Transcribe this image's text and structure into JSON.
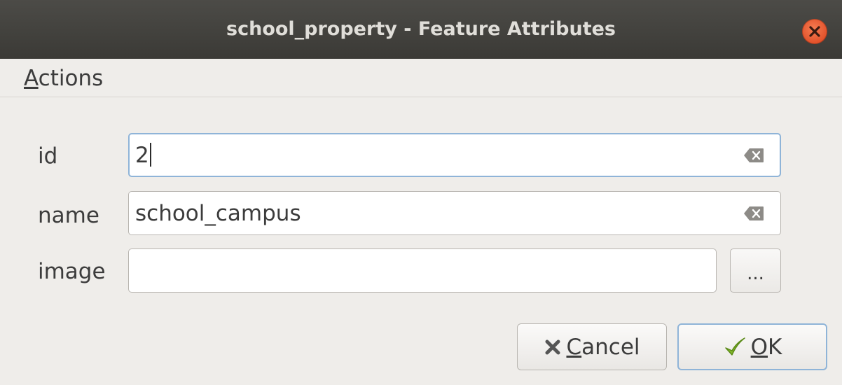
{
  "window": {
    "title": "school_property - Feature Attributes"
  },
  "menubar": {
    "items": [
      {
        "mnemonic": "A",
        "rest": "ctions"
      }
    ]
  },
  "form": {
    "fields": [
      {
        "label": "id",
        "value": "2",
        "focused": true,
        "has_clear": true
      },
      {
        "label": "name",
        "value": "school_campus",
        "focused": false,
        "has_clear": true
      },
      {
        "label": "image",
        "value": "",
        "focused": false,
        "has_clear": false
      }
    ],
    "browse_label": "..."
  },
  "buttons": {
    "cancel": {
      "mnemonic": "C",
      "rest": "ancel",
      "icon": "x-icon"
    },
    "ok": {
      "mnemonic": "O",
      "rest": "K",
      "icon": "checkmark-icon",
      "default": true
    }
  },
  "icons": {
    "close": "close-icon",
    "clear": "clear-text-icon"
  },
  "colors": {
    "titlebar": "#3f3e3a",
    "close_button": "#e2512a",
    "focus_border": "#8fb4d8",
    "checkmark": "#6da41b"
  }
}
